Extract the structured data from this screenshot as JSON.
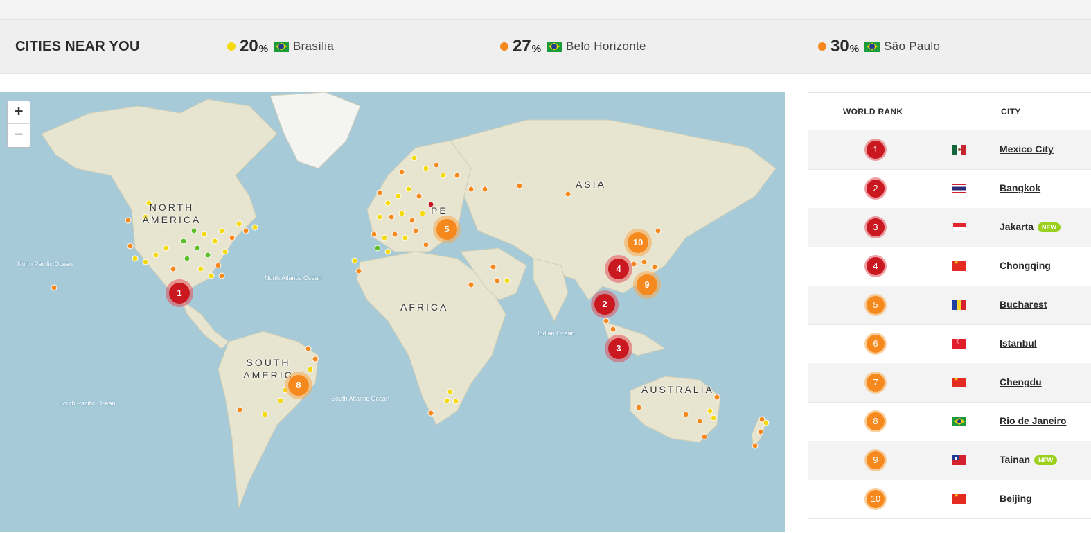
{
  "header": {
    "title": "CITIES NEAR YOU",
    "pct_sign": "%",
    "near": [
      {
        "pct": "20",
        "city": "Brasília",
        "dot_color": "#f4d90e"
      },
      {
        "pct": "27",
        "city": "Belo Horizonte",
        "dot_color": "#f6891e"
      },
      {
        "pct": "30",
        "city": "São Paulo",
        "dot_color": "#f6891e"
      }
    ]
  },
  "map": {
    "zoom_in": "+",
    "zoom_out": "−",
    "regions": {
      "north_america": "NORTH AMERICA",
      "south_america": "SOUTH AMERIC",
      "africa": "AFRICA",
      "asia": "ASIA",
      "europe": "PE",
      "australia": "AUSTRALIA"
    },
    "oceans": {
      "north_pacific": "North Pacific Ocean",
      "north_atlantic": "North Atlantic Ocean",
      "indian": "Indian Ocean",
      "south_atlantic": "South Atlantic Ocean",
      "south_pacific": "South Pacific Ocean"
    },
    "clusters": [
      "1",
      "2",
      "3",
      "4",
      "5",
      "8",
      "9",
      "10"
    ],
    "colors": {
      "good": "#5fbf2a",
      "moderate": "#f4d90e",
      "high": "#f6891e",
      "severe": "#c91820"
    }
  },
  "rankings": {
    "headers": {
      "rank": "WORLD RANK",
      "city": "CITY"
    },
    "new_label": "NEW",
    "rows": [
      {
        "rank": "1",
        "city": "Mexico City",
        "is_new": false,
        "level": "red",
        "flag": "mexico-flag-icon"
      },
      {
        "rank": "2",
        "city": "Bangkok",
        "is_new": false,
        "level": "red",
        "flag": "thailand-flag-icon"
      },
      {
        "rank": "3",
        "city": "Jakarta",
        "is_new": true,
        "level": "red",
        "flag": "indonesia-flag-icon"
      },
      {
        "rank": "4",
        "city": "Chongqing",
        "is_new": false,
        "level": "red",
        "flag": "china-flag-icon"
      },
      {
        "rank": "5",
        "city": "Bucharest",
        "is_new": false,
        "level": "orange",
        "flag": "romania-flag-icon"
      },
      {
        "rank": "6",
        "city": "Istanbul",
        "is_new": false,
        "level": "orange",
        "flag": "turkey-flag-icon"
      },
      {
        "rank": "7",
        "city": "Chengdu",
        "is_new": false,
        "level": "orange",
        "flag": "china-flag-icon"
      },
      {
        "rank": "8",
        "city": "Rio de Janeiro",
        "is_new": false,
        "level": "orange",
        "flag": "brazil-flag-icon"
      },
      {
        "rank": "9",
        "city": "Tainan",
        "is_new": true,
        "level": "orange",
        "flag": "taiwan-flag-icon"
      },
      {
        "rank": "10",
        "city": "Beijing",
        "is_new": false,
        "level": "orange",
        "flag": "china-flag-icon"
      }
    ]
  }
}
